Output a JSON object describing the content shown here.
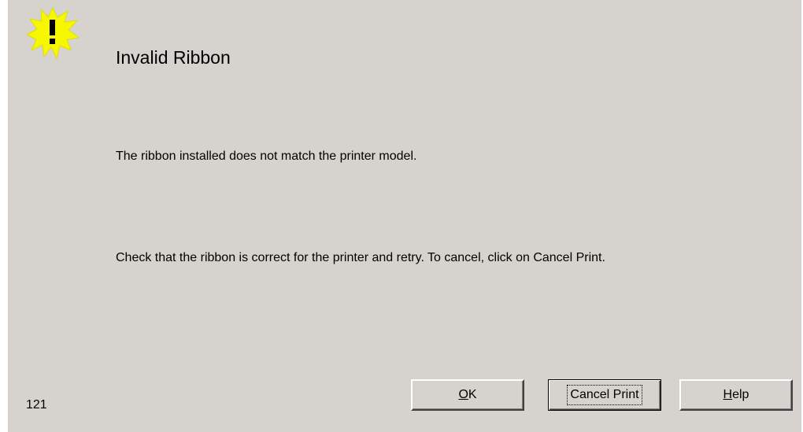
{
  "dialog": {
    "icon": "warning-exclamation-icon",
    "title": "Invalid Ribbon",
    "message_1": "The ribbon installed does not match the printer model.",
    "message_2": "Check that the ribbon is correct for the printer and retry. To cancel, click on Cancel Print.",
    "error_code": "121"
  },
  "buttons": {
    "ok": {
      "accel": "O",
      "rest": "K"
    },
    "cancel_print": {
      "label": "Cancel Print"
    },
    "help": {
      "accel": "H",
      "rest": "elp"
    }
  },
  "colors": {
    "dialog_background": "#d6d3ce",
    "icon_yellow": "#f7f700",
    "text": "#000000"
  }
}
